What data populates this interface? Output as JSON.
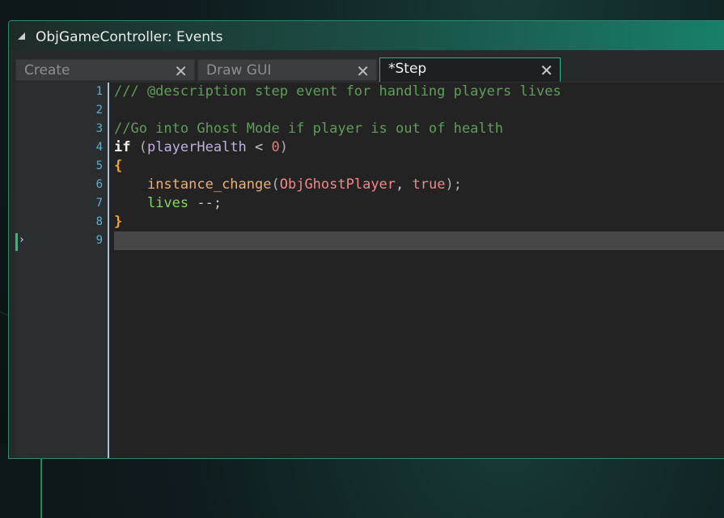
{
  "window": {
    "title": "ObjGameController: Events"
  },
  "tabs": [
    {
      "label": "Create",
      "active": false
    },
    {
      "label": "Draw GUI",
      "active": false
    },
    {
      "label": "*Step",
      "active": true
    }
  ],
  "icons": {
    "close": "close-icon",
    "grip": "window-grip-icon"
  },
  "editor": {
    "current_line": 9,
    "line_numbers": [
      "1",
      "2",
      "3",
      "4",
      "5",
      "6",
      "7",
      "8",
      "9"
    ],
    "lines": [
      [
        {
          "t": "/// @description step event for handling players lives",
          "c": "comment"
        }
      ],
      [],
      [
        {
          "t": "//Go into Ghost Mode if player is out of health",
          "c": "comment"
        }
      ],
      [
        {
          "t": "if",
          "c": "kw"
        },
        {
          "t": " (",
          "c": "paren"
        },
        {
          "t": "playerHealth",
          "c": "var"
        },
        {
          "t": " < ",
          "c": "op"
        },
        {
          "t": "0",
          "c": "num"
        },
        {
          "t": ")",
          "c": "paren"
        }
      ],
      [
        {
          "t": "{",
          "c": "brace"
        }
      ],
      [
        {
          "t": "    ",
          "c": "op"
        },
        {
          "t": "instance_change",
          "c": "func"
        },
        {
          "t": "(",
          "c": "paren"
        },
        {
          "t": "ObjGhostPlayer",
          "c": "obj"
        },
        {
          "t": ", ",
          "c": "op"
        },
        {
          "t": "true",
          "c": "bool"
        },
        {
          "t": ");",
          "c": "paren"
        }
      ],
      [
        {
          "t": "    ",
          "c": "op"
        },
        {
          "t": "lives",
          "c": "local"
        },
        {
          "t": " --;",
          "c": "op"
        }
      ],
      [
        {
          "t": "}",
          "c": "brace"
        }
      ],
      []
    ]
  },
  "colors": {
    "accent": "#2bb08a",
    "line_number": "#5fb0cc",
    "comment": "#5f9e58",
    "current_line_bg": "#474747"
  }
}
